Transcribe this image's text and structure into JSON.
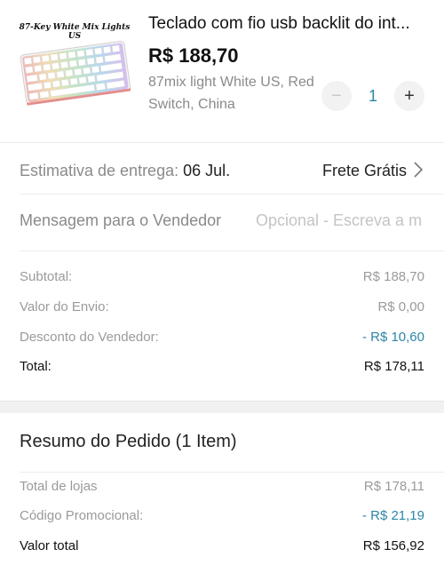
{
  "product": {
    "image_caption": "87-Key White Mix Lights US",
    "title": "Teclado com fio usb backlit do int...",
    "price": "R$ 188,70",
    "variant": "87mix light White US, Red Switch, China",
    "quantity": "1",
    "minus_symbol": "−",
    "plus_symbol": "+"
  },
  "delivery": {
    "label": "Estimativa de entrega:",
    "date": "06 Jul.",
    "shipping": "Frete Grátis"
  },
  "message": {
    "label": "Mensagem para o Vendedor",
    "placeholder": "Opcional - Escreva a m"
  },
  "costs": {
    "subtotal_label": "Subtotal:",
    "subtotal_value": "R$ 188,70",
    "shipping_label": "Valor do Envio:",
    "shipping_value": "R$ 0,00",
    "discount_label": "Desconto do Vendedor:",
    "discount_value": "- R$ 10,60",
    "total_label": "Total:",
    "total_value": "R$ 178,11"
  },
  "summary": {
    "title": "Resumo do Pedido (1 Item)",
    "stores_label": "Total de lojas",
    "stores_value": "R$ 178,11",
    "promo_label": "Código Promocional:",
    "promo_value": "- R$ 21,19",
    "grand_label": "Valor total",
    "grand_value": "R$ 156,92"
  },
  "colors": {
    "accent": "#2d86a6",
    "muted": "#9a9a9a"
  },
  "icons": [
    "chevron-right-icon",
    "minus-icon",
    "plus-icon"
  ]
}
